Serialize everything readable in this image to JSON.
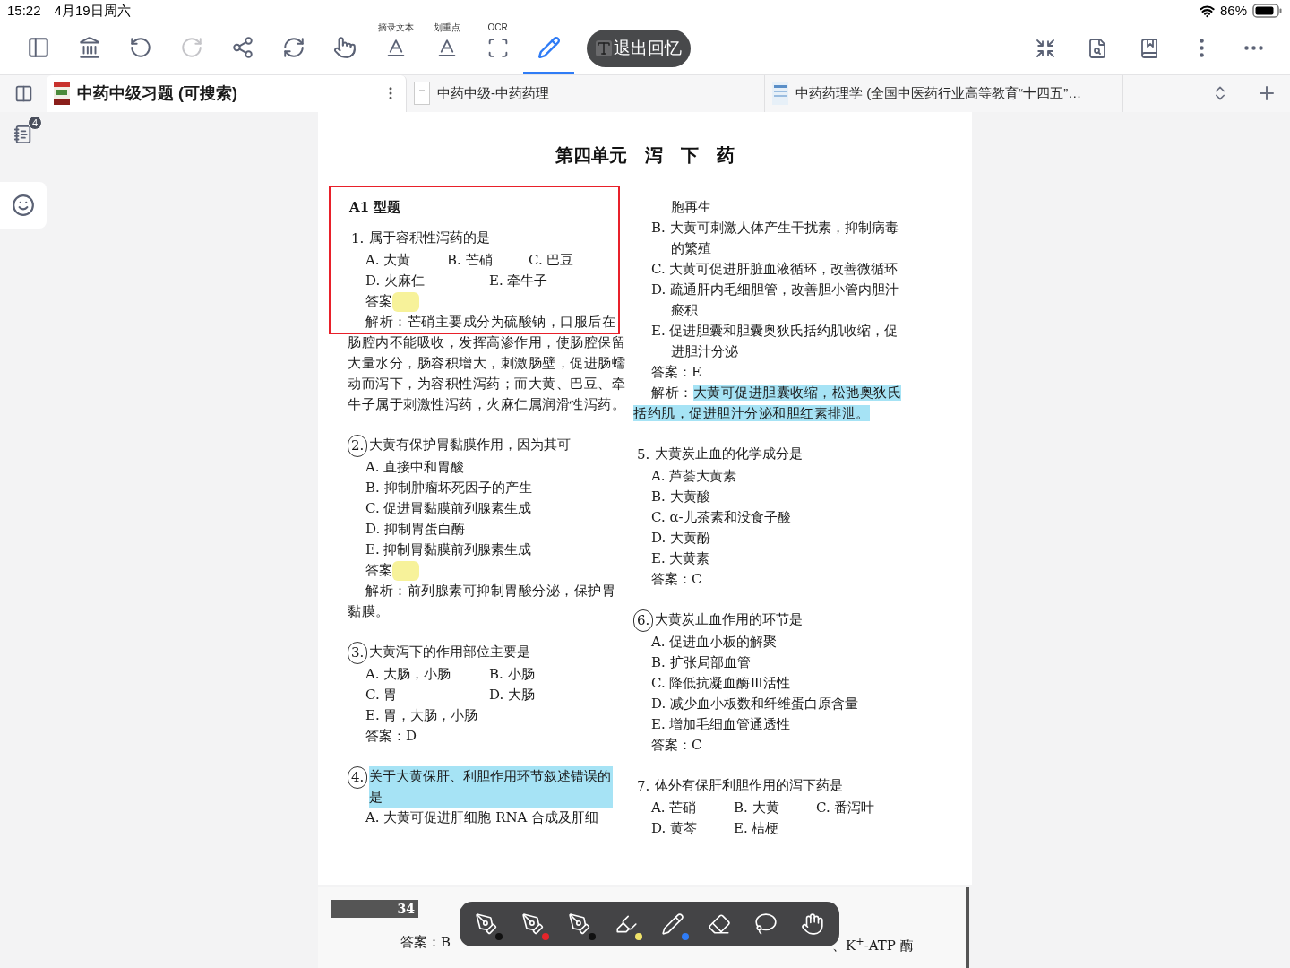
{
  "status_bar": {
    "time": "15:22",
    "date": "4月19日周六",
    "battery": "86%"
  },
  "toolbar": {
    "tools": [
      {
        "selected": false,
        "disabled": false
      },
      {
        "selected": false,
        "disabled": false
      },
      {
        "selected": false,
        "disabled": false
      },
      {
        "selected": false,
        "disabled": true
      },
      {
        "selected": false,
        "disabled": false
      },
      {
        "selected": false,
        "disabled": false
      },
      {
        "selected": false,
        "disabled": false
      },
      {
        "label": "摘录文本",
        "selected": false,
        "disabled": false
      },
      {
        "label": "划重点",
        "selected": false,
        "disabled": false
      },
      {
        "label": "OCR",
        "selected": false,
        "disabled": false
      },
      {
        "selected": true,
        "disabled": false
      }
    ],
    "exit_button": {
      "label": "退出回忆"
    }
  },
  "tabs": [
    {
      "title": "中药中级习题 (可搜索)",
      "selected": true
    },
    {
      "title": "中药中级-中药药理",
      "selected": false
    },
    {
      "title": "中药药理学 (全国中医药行业高等教育“十四五”…",
      "selected": false
    }
  ],
  "sidebar": {
    "notes_badge": "4"
  },
  "document": {
    "title": "第四单元　泻　下　药",
    "left": [
      {
        "kind": "heading",
        "text": "A1 型题"
      },
      {
        "kind": "question",
        "number": "1.",
        "text": "属于容积性泻药的是",
        "circled": false,
        "highlighted": false
      },
      {
        "kind": "options",
        "items": [
          "A. 大黄",
          "B. 芒硝",
          "C. 巴豆"
        ]
      },
      {
        "kind": "options",
        "items": [
          "D. 火麻仁",
          "E. 牵牛子"
        ]
      },
      {
        "kind": "answer",
        "text": "答案",
        "masked": true
      },
      {
        "kind": "analysis",
        "label": "解析：",
        "text": "芒硝主要成分为硫酸钠，口服后在肠腔内不能吸收，发挥高渗作用，使肠腔保留大量水分，肠容积增大，刺激肠壁，促进肠蠕动而泻下，为容积性泻药；而大黄、巴豆、牵牛子属于刺激性泻药，火麻仁属润滑性泻药。",
        "highlighted": false
      },
      {
        "kind": "question",
        "number": "2.",
        "text": "大黄有保护胃黏膜作用，因为其可",
        "circled": true,
        "highlighted": false
      },
      {
        "kind": "option",
        "text": "A. 直接中和胃酸"
      },
      {
        "kind": "option",
        "text": "B. 抑制肿瘤坏死因子的产生"
      },
      {
        "kind": "option",
        "text": "C. 促进胃黏膜前列腺素生成"
      },
      {
        "kind": "option",
        "text": "D. 抑制胃蛋白酶"
      },
      {
        "kind": "option",
        "text": "E. 抑制胃黏膜前列腺素生成"
      },
      {
        "kind": "answer",
        "text": "答案",
        "masked": true
      },
      {
        "kind": "analysis",
        "label": "解析：",
        "text": "前列腺素可抑制胃酸分泌，保护胃黏膜。",
        "highlighted": false
      },
      {
        "kind": "question",
        "number": "3.",
        "text": "大黄泻下的作用部位主要是",
        "circled": true,
        "highlighted": false
      },
      {
        "kind": "options",
        "items": [
          "A. 大肠，小肠",
          "B. 小肠"
        ]
      },
      {
        "kind": "options",
        "items": [
          "C. 胃",
          "D. 大肠"
        ]
      },
      {
        "kind": "option",
        "text": "E. 胃，大肠，小肠"
      },
      {
        "kind": "answer",
        "text": "答案：D",
        "masked": false
      },
      {
        "kind": "question",
        "number": "4.",
        "text": "关于大黄保肝、利胆作用环节叙述错误的是",
        "circled": true,
        "highlighted": true
      },
      {
        "kind": "option",
        "text": "A. 大黄可促进肝细胞 RNA 合成及肝细"
      }
    ],
    "right": [
      {
        "kind": "continuation",
        "text": "胞再生"
      },
      {
        "kind": "option",
        "text": "B. 大黄可刺激人体产生干扰素，抑制病毒的繁殖"
      },
      {
        "kind": "option",
        "text": "C. 大黄可促进肝脏血液循环，改善微循环"
      },
      {
        "kind": "option",
        "text": "D. 疏通肝内毛细胆管，改善胆小管内胆汁瘀积"
      },
      {
        "kind": "option",
        "text": "E. 促进胆囊和胆囊奥狄氏括约肌收缩，促进胆汁分泌"
      },
      {
        "kind": "answer",
        "text": "答案：E",
        "masked": false
      },
      {
        "kind": "analysis",
        "label": "解析：",
        "text": "大黄可促进胆囊收缩，松弛奥狄氏括约肌，促进胆汁分泌和胆红素排泄。",
        "highlighted": true
      },
      {
        "kind": "question",
        "number": "5.",
        "text": "大黄炭止血的化学成分是",
        "circled": false,
        "highlighted": false
      },
      {
        "kind": "option",
        "text": "A. 芦荟大黄素"
      },
      {
        "kind": "option",
        "text": "B. 大黄酸"
      },
      {
        "kind": "option",
        "text": "C. α-儿茶素和没食子酸"
      },
      {
        "kind": "option",
        "text": "D. 大黄酚"
      },
      {
        "kind": "option",
        "text": "E. 大黄素"
      },
      {
        "kind": "answer",
        "text": "答案：C",
        "masked": false
      },
      {
        "kind": "question",
        "number": "6.",
        "text": "大黄炭止血作用的环节是",
        "circled": true,
        "highlighted": false
      },
      {
        "kind": "option",
        "text": "A. 促进血小板的解聚"
      },
      {
        "kind": "option",
        "text": "B. 扩张局部血管"
      },
      {
        "kind": "option",
        "text": "C. 降低抗凝血酶Ⅲ活性"
      },
      {
        "kind": "option",
        "text": "D. 减少血小板数和纤维蛋白原含量"
      },
      {
        "kind": "option",
        "text": "E. 增加毛细血管通透性"
      },
      {
        "kind": "answer",
        "text": "答案：C",
        "masked": false
      },
      {
        "kind": "question",
        "number": "7.",
        "text": "体外有保肝利胆作用的泻下药是",
        "circled": false,
        "highlighted": false
      },
      {
        "kind": "options",
        "items": [
          "A. 芒硝",
          "B. 大黄",
          "C. 番泻叶"
        ]
      },
      {
        "kind": "options",
        "items": [
          "D. 黄芩",
          "E. 桔梗"
        ]
      }
    ]
  },
  "next_page": {
    "stamp": "34",
    "answer": "答案：B",
    "fragment": "、K$^{+}$-ATP 酶"
  },
  "pen_palette": [
    {
      "kind": "pen",
      "color": "#111111"
    },
    {
      "kind": "pen",
      "color": "#e5252a"
    },
    {
      "kind": "pen",
      "color": "#111111"
    },
    {
      "kind": "highlighter",
      "color": "#f0e36a"
    },
    {
      "kind": "pencil",
      "color": "#2f7cf6"
    },
    {
      "kind": "eraser"
    },
    {
      "kind": "lasso"
    },
    {
      "kind": "hand"
    }
  ]
}
